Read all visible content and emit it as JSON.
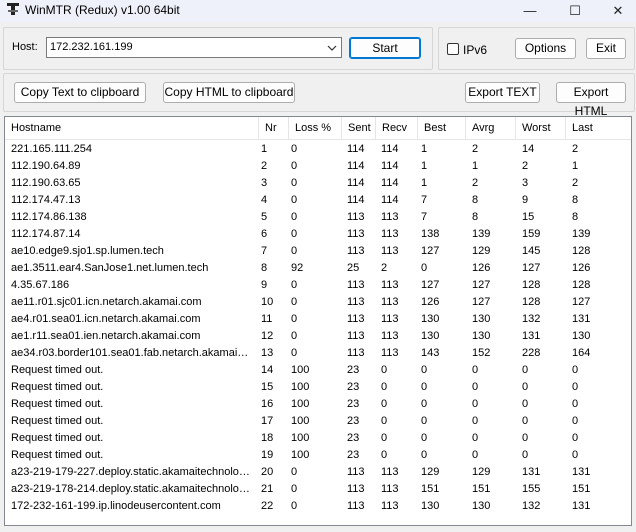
{
  "window": {
    "title": "WinMTR (Redux) v1.00 64bit",
    "minimize": "—",
    "maximize": "☐",
    "close": "✕"
  },
  "toolbar": {
    "host_label": "Host:",
    "host_value": "172.232.161.199",
    "start": "Start",
    "ipv6": "IPv6",
    "options": "Options",
    "exit": "Exit",
    "copy_text": "Copy Text to clipboard",
    "copy_html": "Copy HTML to clipboard",
    "export_text": "Export TEXT",
    "export_html": "Export HTML"
  },
  "table": {
    "columns": [
      "Hostname",
      "Nr",
      "Loss %",
      "Sent",
      "Recv",
      "Best",
      "Avrg",
      "Worst",
      "Last"
    ],
    "rows": [
      [
        "221.165.111.254",
        "1",
        "0",
        "114",
        "114",
        "1",
        "2",
        "14",
        "2"
      ],
      [
        "112.190.64.89",
        "2",
        "0",
        "114",
        "114",
        "1",
        "1",
        "2",
        "1"
      ],
      [
        "112.190.63.65",
        "3",
        "0",
        "114",
        "114",
        "1",
        "2",
        "3",
        "2"
      ],
      [
        "112.174.47.13",
        "4",
        "0",
        "114",
        "114",
        "7",
        "8",
        "9",
        "8"
      ],
      [
        "112.174.86.138",
        "5",
        "0",
        "113",
        "113",
        "7",
        "8",
        "15",
        "8"
      ],
      [
        "112.174.87.14",
        "6",
        "0",
        "113",
        "113",
        "138",
        "139",
        "159",
        "139"
      ],
      [
        "ae10.edge9.sjo1.sp.lumen.tech",
        "7",
        "0",
        "113",
        "113",
        "127",
        "129",
        "145",
        "128"
      ],
      [
        "ae1.3511.ear4.SanJose1.net.lumen.tech",
        "8",
        "92",
        "25",
        "2",
        "0",
        "126",
        "127",
        "126"
      ],
      [
        "4.35.67.186",
        "9",
        "0",
        "113",
        "113",
        "127",
        "127",
        "128",
        "128"
      ],
      [
        "ae11.r01.sjc01.icn.netarch.akamai.com",
        "10",
        "0",
        "113",
        "113",
        "126",
        "127",
        "128",
        "127"
      ],
      [
        "ae4.r01.sea01.icn.netarch.akamai.com",
        "11",
        "0",
        "113",
        "113",
        "130",
        "130",
        "132",
        "131"
      ],
      [
        "ae1.r11.sea01.ien.netarch.akamai.com",
        "12",
        "0",
        "113",
        "113",
        "130",
        "130",
        "131",
        "130"
      ],
      [
        "ae34.r03.border101.sea01.fab.netarch.akamai.c...",
        "13",
        "0",
        "113",
        "113",
        "143",
        "152",
        "228",
        "164"
      ],
      [
        "Request timed out.",
        "14",
        "100",
        "23",
        "0",
        "0",
        "0",
        "0",
        "0"
      ],
      [
        "Request timed out.",
        "15",
        "100",
        "23",
        "0",
        "0",
        "0",
        "0",
        "0"
      ],
      [
        "Request timed out.",
        "16",
        "100",
        "23",
        "0",
        "0",
        "0",
        "0",
        "0"
      ],
      [
        "Request timed out.",
        "17",
        "100",
        "23",
        "0",
        "0",
        "0",
        "0",
        "0"
      ],
      [
        "Request timed out.",
        "18",
        "100",
        "23",
        "0",
        "0",
        "0",
        "0",
        "0"
      ],
      [
        "Request timed out.",
        "19",
        "100",
        "23",
        "0",
        "0",
        "0",
        "0",
        "0"
      ],
      [
        "a23-219-179-227.deploy.static.akamaitechnologi...",
        "20",
        "0",
        "113",
        "113",
        "129",
        "129",
        "131",
        "131"
      ],
      [
        "a23-219-178-214.deploy.static.akamaitechnologi...",
        "21",
        "0",
        "113",
        "113",
        "151",
        "151",
        "155",
        "151"
      ],
      [
        "172-232-161-199.ip.linodeusercontent.com",
        "22",
        "0",
        "113",
        "113",
        "130",
        "130",
        "132",
        "131"
      ]
    ]
  }
}
